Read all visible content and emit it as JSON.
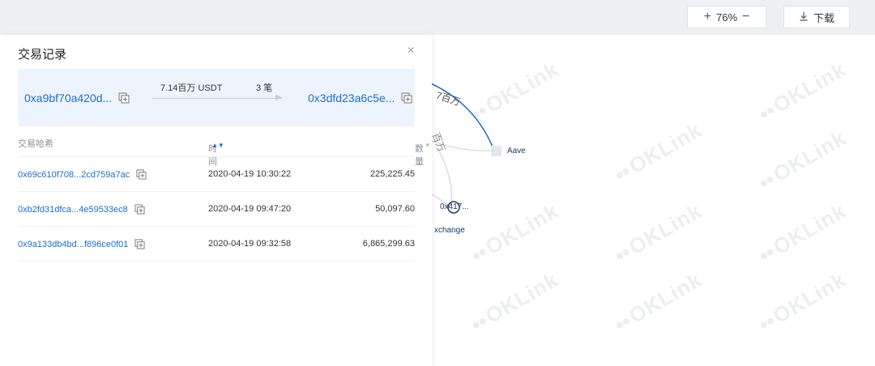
{
  "toolbar": {
    "zoom_in_symbol": "+",
    "zoom_level": "76%",
    "zoom_out_symbol": "−",
    "download_label": "下载"
  },
  "graph": {
    "edge_labels": [
      "7百万",
      "百万"
    ],
    "nodes": [
      {
        "label": "Aave"
      },
      {
        "label": "0x417..."
      },
      {
        "label": "xchange"
      }
    ],
    "watermark_text": "OKLink"
  },
  "panel": {
    "title": "交易记录",
    "close_symbol": "×",
    "summary": {
      "from_address": "0xa9bf70a420d...",
      "to_address": "0x3dfd23a6c5e...",
      "amount": "7.14百万 USDT",
      "tx_count": "3 笔"
    },
    "columns": {
      "hash": "交易哈希",
      "time": "时间",
      "quantity": "数量"
    },
    "rows": [
      {
        "hash": "0x69c610f708...2cd759a7ac",
        "time": "2020-04-19 10:30:22",
        "quantity": "225,225.45"
      },
      {
        "hash": "0xb2fd31dfca...4e59533ec8",
        "time": "2020-04-19 09:47:20",
        "quantity": "50,097.60"
      },
      {
        "hash": "0x9a133db4bd...f896ce0f01",
        "time": "2020-04-19 09:32:58",
        "quantity": "6,865,299.63"
      }
    ]
  },
  "colors": {
    "accent": "#1b6ed2",
    "summary_bg": "#eef4fd",
    "topbar_bg": "#eef0f4"
  }
}
